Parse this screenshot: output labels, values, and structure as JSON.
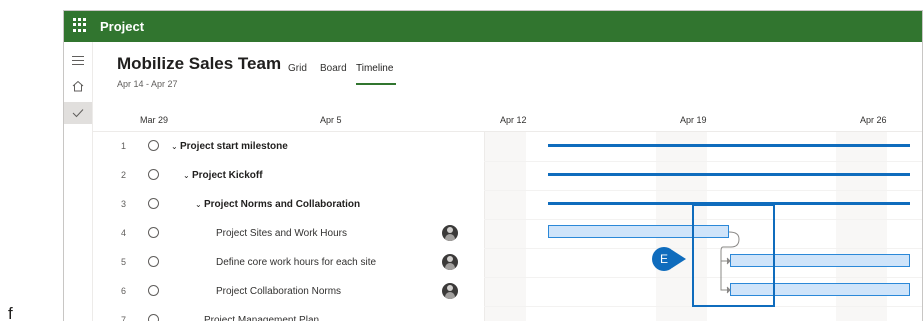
{
  "outer_label": "f",
  "app": {
    "title": "Project"
  },
  "plan": {
    "title": "Mobilize Sales Team",
    "dates": "Apr 14 - Apr 27",
    "tabs": [
      "Grid",
      "Board",
      "Timeline"
    ],
    "selected_tab": "Timeline"
  },
  "timeline_dates": [
    "Mar 29",
    "Apr 5",
    "Apr 12",
    "Apr 19",
    "Apr 26"
  ],
  "tasks": [
    {
      "num": "1",
      "name": "Project start milestone",
      "bold": true,
      "chevron": true
    },
    {
      "num": "2",
      "name": "Project Kickoff",
      "bold": true,
      "chevron": true
    },
    {
      "num": "3",
      "name": "Project Norms and Collaboration",
      "bold": true,
      "chevron": true
    },
    {
      "num": "4",
      "name": "Project Sites and Work Hours",
      "bold": false,
      "avatar": true
    },
    {
      "num": "5",
      "name": "Define core work hours for each site",
      "bold": false,
      "avatar": true
    },
    {
      "num": "6",
      "name": "Project Collaboration Norms",
      "bold": false,
      "avatar": true
    },
    {
      "num": "7",
      "name": "Project Management Plan",
      "bold": false
    }
  ],
  "callout": {
    "label": "E"
  },
  "colors": {
    "brand": "#31752f",
    "accent": "#0f6cbd",
    "bar_fill": "#cfe4fa"
  },
  "icons": {
    "waffle": "waffle-icon",
    "menu": "hamburger-icon",
    "home": "home-icon",
    "check": "checkmark-icon"
  }
}
